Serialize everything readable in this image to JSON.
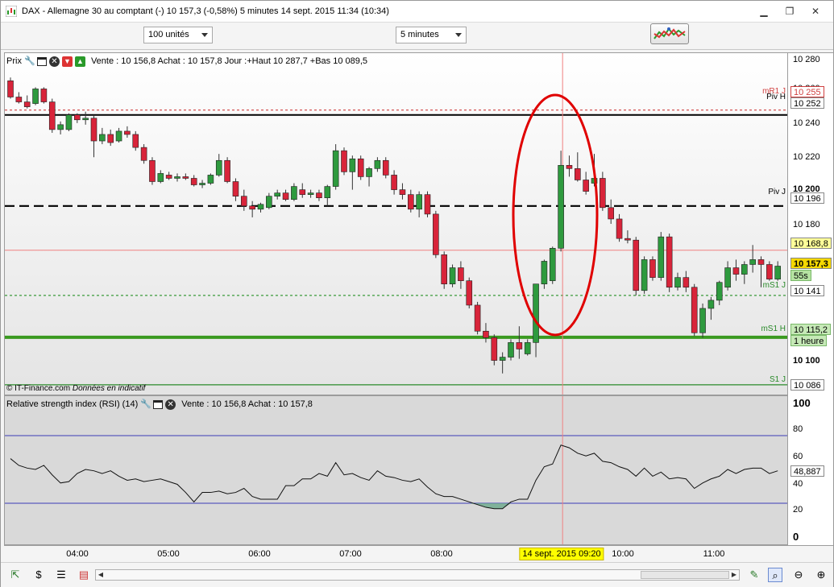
{
  "window": {
    "title": "DAX - Allemagne 30 au comptant (-)    10 157,3 (-0,58%)    5 minutes  14 sept. 2015 11:34 (10:34)",
    "buttons": {
      "minimize": "▁",
      "restore": "❐",
      "close": "✕"
    }
  },
  "toolbar": {
    "units_select": "100 unités",
    "period_select": "5 minutes",
    "indicators_button_icon": "indicators-icon"
  },
  "price_pane": {
    "header_label": "Prix",
    "quote_text": "Vente : 10 156,8 Achat : 10 157,8 Jour :+Haut 10 287,7 +Bas 10 089,5",
    "copyright": "© IT-Finance.com",
    "disclaimer": "Données en indicatif",
    "icons": [
      "wrench-icon",
      "window-icon",
      "close-icon",
      "sell-icon",
      "buy-icon"
    ],
    "line_labels": {
      "mr1": "mR1 J",
      "piv_h": "Piv H",
      "piv_j": "Piv J",
      "ms1_j": "mS1 J",
      "ms1_h": "mS1 H",
      "s1_j": "S1 J"
    }
  },
  "price_axis": {
    "ticks": [
      "10 280",
      "10 260",
      "10 240",
      "10 220",
      "10 200",
      "10 180",
      "10 160",
      "10 140",
      "10 120",
      "10 100"
    ],
    "tags": {
      "mr1_value": "10 255",
      "piv_h_value": "10 252",
      "piv_j_value": "10 196",
      "cursor_value": "10 168,8",
      "last_price": "10 157,3",
      "countdown": "55s",
      "ms1_j_value": "10 141",
      "ms1_h_value": "10 115,2",
      "ms1_h_period": "1 heure",
      "s1_j_value": "10 086"
    },
    "colors": {
      "last_price_bg": "#f5d800",
      "cursor_tag_bg": "#ffff99",
      "countdown_bg": "#b6e3a2",
      "ms1_h_bg": "#c6e9b7"
    }
  },
  "rsi_pane": {
    "header_label": "Relative strength index (RSI) (14)",
    "quote_text": "Vente : 10 156,8 Achat : 10 157,8",
    "icons": [
      "wrench-icon",
      "window-icon",
      "close-icon"
    ],
    "axis_ticks": [
      "100",
      "80",
      "60",
      "40",
      "20",
      "0"
    ],
    "current_value": "48,887"
  },
  "time_axis": {
    "labels": [
      "04:00",
      "05:00",
      "06:00",
      "07:00",
      "08:00",
      "10:00",
      "11:00"
    ],
    "cursor_label": "14 sept. 2015 09:20"
  },
  "bottom_bar": {
    "left_icons": [
      "cursor-tool-icon",
      "dollar-tool-icon",
      "list-tool-icon",
      "bars-tool-icon"
    ],
    "right_icons": [
      "draw-tool-icon",
      "zoom-fit-icon",
      "zoom-out-icon",
      "zoom-in-icon"
    ]
  },
  "chart_data": {
    "type": "candlestick",
    "instrument": "DAX - Allemagne 30 au comptant (-)",
    "timeframe": "5 minutes",
    "ylim": [
      10080,
      10290
    ],
    "x_ticks": [
      "04:00",
      "05:00",
      "06:00",
      "07:00",
      "08:00",
      "10:00",
      "11:00"
    ],
    "candles": [
      [
        10273,
        10275,
        10262,
        10263
      ],
      [
        10263,
        10266,
        10259,
        10260
      ],
      [
        10260,
        10264,
        10256,
        10257
      ],
      [
        10259,
        10269,
        10258,
        10268
      ],
      [
        10268,
        10269,
        10259,
        10260
      ],
      [
        10260,
        10262,
        10241,
        10243
      ],
      [
        10243,
        10248,
        10240,
        10246
      ],
      [
        10243,
        10253,
        10242,
        10252
      ],
      [
        10252,
        10253,
        10247,
        10249
      ],
      [
        10249,
        10254,
        10246,
        10250
      ],
      [
        10250,
        10252,
        10226,
        10236
      ],
      [
        10236,
        10244,
        10234,
        10240
      ],
      [
        10240,
        10243,
        10233,
        10235
      ],
      [
        10236,
        10244,
        10235,
        10242
      ],
      [
        10242,
        10245,
        10238,
        10240
      ],
      [
        10240,
        10242,
        10230,
        10232
      ],
      [
        10232,
        10234,
        10222,
        10224
      ],
      [
        10224,
        10226,
        10209,
        10211
      ],
      [
        10211,
        10218,
        10210,
        10216
      ],
      [
        10215,
        10217,
        10212,
        10213
      ],
      [
        10213,
        10216,
        10211,
        10214
      ],
      [
        10214,
        10216,
        10212,
        10213
      ],
      [
        10213,
        10215,
        10208,
        10209
      ],
      [
        10209,
        10212,
        10207,
        10210
      ],
      [
        10210,
        10216,
        10209,
        10215
      ],
      [
        10215,
        10228,
        10214,
        10224
      ],
      [
        10224,
        10226,
        10210,
        10211
      ],
      [
        10211,
        10213,
        10199,
        10202
      ],
      [
        10202,
        10206,
        10193,
        10196
      ],
      [
        10196,
        10199,
        10189,
        10194
      ],
      [
        10194,
        10198,
        10192,
        10197
      ],
      [
        10195,
        10204,
        10194,
        10202
      ],
      [
        10202,
        10206,
        10200,
        10204
      ],
      [
        10204,
        10206,
        10199,
        10200
      ],
      [
        10200,
        10210,
        10199,
        10208
      ],
      [
        10206,
        10210,
        10201,
        10203
      ],
      [
        10203,
        10206,
        10201,
        10204
      ],
      [
        10204,
        10206,
        10199,
        10201
      ],
      [
        10201,
        10209,
        10196,
        10208
      ],
      [
        10208,
        10234,
        10206,
        10230
      ],
      [
        10230,
        10232,
        10215,
        10217
      ],
      [
        10217,
        10227,
        10206,
        10225
      ],
      [
        10225,
        10227,
        10212,
        10214
      ],
      [
        10214,
        10220,
        10208,
        10219
      ],
      [
        10219,
        10226,
        10217,
        10224
      ],
      [
        10224,
        10226,
        10213,
        10215
      ],
      [
        10215,
        10218,
        10203,
        10206
      ],
      [
        10206,
        10210,
        10200,
        10203
      ],
      [
        10203,
        10206,
        10192,
        10194
      ],
      [
        10194,
        10205,
        10189,
        10203
      ],
      [
        10203,
        10205,
        10189,
        10191
      ],
      [
        10191,
        10193,
        10164,
        10166
      ],
      [
        10166,
        10168,
        10145,
        10148
      ],
      [
        10148,
        10160,
        10146,
        10158
      ],
      [
        10158,
        10162,
        10145,
        10150
      ],
      [
        10150,
        10152,
        10133,
        10135
      ],
      [
        10135,
        10137,
        10117,
        10119
      ],
      [
        10119,
        10124,
        10112,
        10115
      ],
      [
        10115,
        10117,
        10098,
        10101
      ],
      [
        10101,
        10106,
        10093,
        10103
      ],
      [
        10103,
        10114,
        10101,
        10112
      ],
      [
        10112,
        10122,
        10102,
        10108
      ],
      [
        10105,
        10114,
        10104,
        10112
      ],
      [
        10112,
        10148,
        10103,
        10148
      ],
      [
        10148,
        10163,
        10145,
        10162
      ],
      [
        10150,
        10171,
        10148,
        10170
      ],
      [
        10170,
        10230,
        10168,
        10221
      ],
      [
        10221,
        10227,
        10214,
        10219
      ],
      [
        10219,
        10229,
        10211,
        10212
      ],
      [
        10212,
        10217,
        10203,
        10205
      ],
      [
        10210,
        10228,
        10208,
        10213
      ],
      [
        10213,
        10217,
        10193,
        10195
      ],
      [
        10195,
        10200,
        10185,
        10188
      ],
      [
        10188,
        10191,
        10174,
        10176
      ],
      [
        10176,
        10181,
        10173,
        10175
      ],
      [
        10175,
        10177,
        10141,
        10144
      ],
      [
        10144,
        10165,
        10142,
        10163
      ],
      [
        10163,
        10165,
        10150,
        10152
      ],
      [
        10152,
        10180,
        10150,
        10177
      ],
      [
        10177,
        10179,
        10143,
        10146
      ],
      [
        10146,
        10155,
        10144,
        10152
      ],
      [
        10152,
        10156,
        10143,
        10146
      ],
      [
        10146,
        10148,
        10116,
        10118
      ],
      [
        10118,
        10136,
        10115,
        10133
      ],
      [
        10133,
        10140,
        10126,
        10138
      ],
      [
        10138,
        10150,
        10135,
        10149
      ],
      [
        10146,
        10162,
        10144,
        10158
      ],
      [
        10158,
        10163,
        10150,
        10154
      ],
      [
        10154,
        10162,
        10148,
        10160
      ],
      [
        10160,
        10172,
        10155,
        10163
      ],
      [
        10163,
        10165,
        10146,
        10160
      ],
      [
        10160,
        10162,
        10150,
        10151
      ],
      [
        10151,
        10162,
        10150,
        10159
      ]
    ],
    "horizontal_lines": [
      {
        "name": "mR1 J",
        "value": 10255,
        "style": "dashed",
        "color": "#d04040"
      },
      {
        "name": "Piv H",
        "value": 10252,
        "style": "solid",
        "color": "#000000"
      },
      {
        "name": "Piv J",
        "value": 10196,
        "style": "dashed",
        "color": "#000000"
      },
      {
        "name": "mS1 J",
        "value": 10141,
        "style": "dashed",
        "color": "#3a9a3a"
      },
      {
        "name": "mS1 H",
        "value": 10115.2,
        "style": "solid",
        "color": "#3a9a20"
      },
      {
        "name": "S1 J",
        "value": 10086,
        "style": "solid",
        "color": "#2a8a2a"
      }
    ],
    "cursor": {
      "time": "14 sept. 2015 09:20",
      "price": 10168.8
    },
    "rsi": {
      "period": 14,
      "ylim": [
        0,
        100
      ],
      "levels": [
        75,
        25
      ],
      "current": 48.887,
      "values": [
        58,
        53,
        51,
        50,
        53,
        46,
        40,
        41,
        47,
        50,
        49,
        47,
        49,
        45,
        42,
        43,
        41,
        42,
        43,
        41,
        39,
        33,
        26,
        33,
        33,
        34,
        32,
        33,
        36,
        30,
        28,
        28,
        28,
        38,
        38,
        43,
        43,
        47,
        45,
        55,
        46,
        47,
        44,
        42,
        49,
        45,
        44,
        42,
        41,
        43,
        37,
        32,
        30,
        30,
        28,
        26,
        24,
        22,
        21,
        21,
        26,
        28,
        28,
        42,
        52,
        54,
        68,
        66,
        62,
        60,
        62,
        56,
        55,
        52,
        50,
        45,
        51,
        45,
        48,
        43,
        44,
        43,
        36,
        40,
        43,
        45,
        50,
        47,
        50,
        51,
        51,
        47,
        49
      ]
    }
  }
}
